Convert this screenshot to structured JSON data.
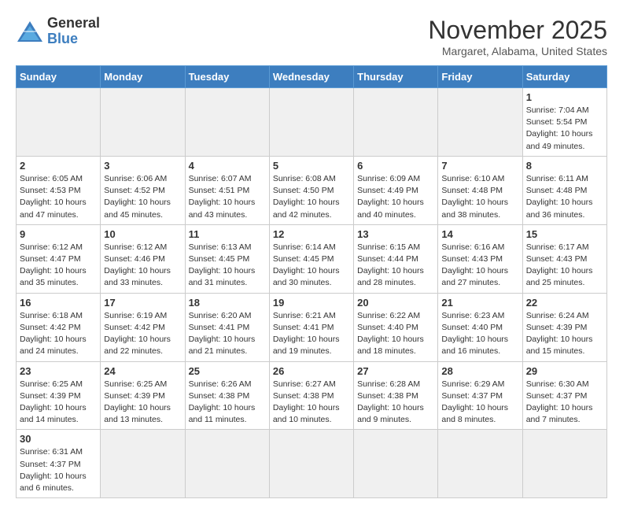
{
  "logo": {
    "line1": "General",
    "line2": "Blue"
  },
  "title": "November 2025",
  "location": "Margaret, Alabama, United States",
  "days_of_week": [
    "Sunday",
    "Monday",
    "Tuesday",
    "Wednesday",
    "Thursday",
    "Friday",
    "Saturday"
  ],
  "weeks": [
    [
      {
        "day": "",
        "info": ""
      },
      {
        "day": "",
        "info": ""
      },
      {
        "day": "",
        "info": ""
      },
      {
        "day": "",
        "info": ""
      },
      {
        "day": "",
        "info": ""
      },
      {
        "day": "",
        "info": ""
      },
      {
        "day": "1",
        "info": "Sunrise: 7:04 AM\nSunset: 5:54 PM\nDaylight: 10 hours and 49 minutes."
      }
    ],
    [
      {
        "day": "2",
        "info": "Sunrise: 6:05 AM\nSunset: 4:53 PM\nDaylight: 10 hours and 47 minutes."
      },
      {
        "day": "3",
        "info": "Sunrise: 6:06 AM\nSunset: 4:52 PM\nDaylight: 10 hours and 45 minutes."
      },
      {
        "day": "4",
        "info": "Sunrise: 6:07 AM\nSunset: 4:51 PM\nDaylight: 10 hours and 43 minutes."
      },
      {
        "day": "5",
        "info": "Sunrise: 6:08 AM\nSunset: 4:50 PM\nDaylight: 10 hours and 42 minutes."
      },
      {
        "day": "6",
        "info": "Sunrise: 6:09 AM\nSunset: 4:49 PM\nDaylight: 10 hours and 40 minutes."
      },
      {
        "day": "7",
        "info": "Sunrise: 6:10 AM\nSunset: 4:48 PM\nDaylight: 10 hours and 38 minutes."
      },
      {
        "day": "8",
        "info": "Sunrise: 6:11 AM\nSunset: 4:48 PM\nDaylight: 10 hours and 36 minutes."
      }
    ],
    [
      {
        "day": "9",
        "info": "Sunrise: 6:12 AM\nSunset: 4:47 PM\nDaylight: 10 hours and 35 minutes."
      },
      {
        "day": "10",
        "info": "Sunrise: 6:12 AM\nSunset: 4:46 PM\nDaylight: 10 hours and 33 minutes."
      },
      {
        "day": "11",
        "info": "Sunrise: 6:13 AM\nSunset: 4:45 PM\nDaylight: 10 hours and 31 minutes."
      },
      {
        "day": "12",
        "info": "Sunrise: 6:14 AM\nSunset: 4:45 PM\nDaylight: 10 hours and 30 minutes."
      },
      {
        "day": "13",
        "info": "Sunrise: 6:15 AM\nSunset: 4:44 PM\nDaylight: 10 hours and 28 minutes."
      },
      {
        "day": "14",
        "info": "Sunrise: 6:16 AM\nSunset: 4:43 PM\nDaylight: 10 hours and 27 minutes."
      },
      {
        "day": "15",
        "info": "Sunrise: 6:17 AM\nSunset: 4:43 PM\nDaylight: 10 hours and 25 minutes."
      }
    ],
    [
      {
        "day": "16",
        "info": "Sunrise: 6:18 AM\nSunset: 4:42 PM\nDaylight: 10 hours and 24 minutes."
      },
      {
        "day": "17",
        "info": "Sunrise: 6:19 AM\nSunset: 4:42 PM\nDaylight: 10 hours and 22 minutes."
      },
      {
        "day": "18",
        "info": "Sunrise: 6:20 AM\nSunset: 4:41 PM\nDaylight: 10 hours and 21 minutes."
      },
      {
        "day": "19",
        "info": "Sunrise: 6:21 AM\nSunset: 4:41 PM\nDaylight: 10 hours and 19 minutes."
      },
      {
        "day": "20",
        "info": "Sunrise: 6:22 AM\nSunset: 4:40 PM\nDaylight: 10 hours and 18 minutes."
      },
      {
        "day": "21",
        "info": "Sunrise: 6:23 AM\nSunset: 4:40 PM\nDaylight: 10 hours and 16 minutes."
      },
      {
        "day": "22",
        "info": "Sunrise: 6:24 AM\nSunset: 4:39 PM\nDaylight: 10 hours and 15 minutes."
      }
    ],
    [
      {
        "day": "23",
        "info": "Sunrise: 6:25 AM\nSunset: 4:39 PM\nDaylight: 10 hours and 14 minutes."
      },
      {
        "day": "24",
        "info": "Sunrise: 6:25 AM\nSunset: 4:39 PM\nDaylight: 10 hours and 13 minutes."
      },
      {
        "day": "25",
        "info": "Sunrise: 6:26 AM\nSunset: 4:38 PM\nDaylight: 10 hours and 11 minutes."
      },
      {
        "day": "26",
        "info": "Sunrise: 6:27 AM\nSunset: 4:38 PM\nDaylight: 10 hours and 10 minutes."
      },
      {
        "day": "27",
        "info": "Sunrise: 6:28 AM\nSunset: 4:38 PM\nDaylight: 10 hours and 9 minutes."
      },
      {
        "day": "28",
        "info": "Sunrise: 6:29 AM\nSunset: 4:37 PM\nDaylight: 10 hours and 8 minutes."
      },
      {
        "day": "29",
        "info": "Sunrise: 6:30 AM\nSunset: 4:37 PM\nDaylight: 10 hours and 7 minutes."
      }
    ],
    [
      {
        "day": "30",
        "info": "Sunrise: 6:31 AM\nSunset: 4:37 PM\nDaylight: 10 hours and 6 minutes."
      },
      {
        "day": "",
        "info": ""
      },
      {
        "day": "",
        "info": ""
      },
      {
        "day": "",
        "info": ""
      },
      {
        "day": "",
        "info": ""
      },
      {
        "day": "",
        "info": ""
      },
      {
        "day": "",
        "info": ""
      }
    ]
  ]
}
